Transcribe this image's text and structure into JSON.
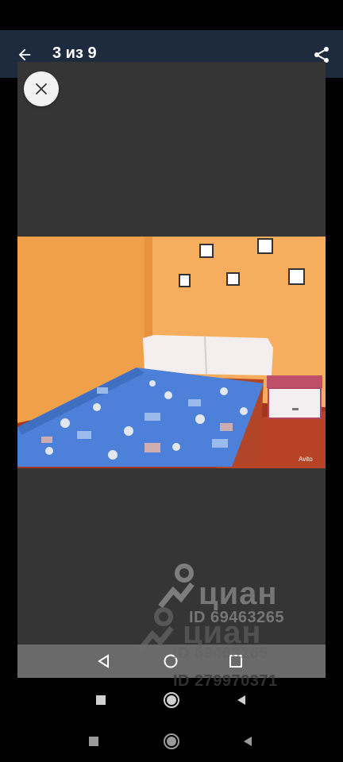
{
  "app_bar": {
    "counter_text": "3 из 9"
  },
  "watermark_primary": {
    "brand": "циан",
    "id_text": "ID 69463265"
  },
  "watermark_secondary": {
    "brand": "циан",
    "id_text": "ID 69463265"
  },
  "watermark_tertiary": {
    "id_text": "ID 279970371"
  },
  "icons": {
    "back": "arrow-left-icon",
    "share": "share-icon",
    "close": "close-icon",
    "nav_back": "triangle-back-icon",
    "nav_home": "circle-home-icon",
    "nav_recents": "square-recents-icon"
  },
  "colors": {
    "app_bar": "#1e2b3e",
    "viewer_bg": "#353535",
    "wall": "#f0a24c",
    "bedspread": "#4c7ed6"
  }
}
